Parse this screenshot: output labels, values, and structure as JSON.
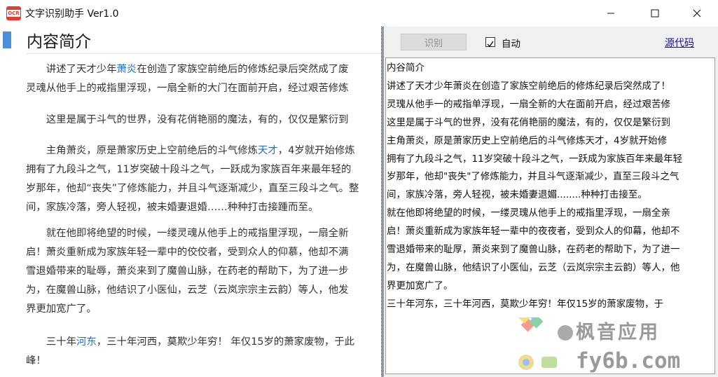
{
  "window": {
    "title": "文字识别助手 Ver1.0",
    "icon_text": "OCR"
  },
  "article": {
    "title": "内容简介",
    "paragraphs": [
      {
        "lines": [
          [
            {
              "t": "　　讲述了天才少年"
            },
            {
              "t": "萧炎",
              "link": true
            },
            {
              "t": "在创造了家族空前绝后的修炼纪录后突然成了废"
            }
          ],
          [
            {
              "t": "灵魂从他手上的戒指里浮现，一扇全新的大门在面前开启，经过艰苦修炼"
            }
          ]
        ]
      },
      {
        "lines": [
          [
            {
              "t": "　　这里是属于斗气的世界，没有花俏艳丽的魔法，有的，仅仅是繁衍到"
            }
          ]
        ]
      },
      {
        "lines": [
          [
            {
              "t": "　　主角萧炎，原是萧家历史上空前绝后的斗气修炼"
            },
            {
              "t": "天才",
              "link": true
            },
            {
              "t": "，4岁就开始修炼"
            }
          ],
          [
            {
              "t": "拥有了九段斗之气，11岁突破十段斗之气，一跃成为家族百年来最年轻的"
            }
          ],
          [
            {
              "t": "岁那年，他却“丧失”了修炼能力，并且斗气逐渐减少，直至三段斗之气。整"
            }
          ],
          [
            {
              "t": "间，家族冷落，旁人轻视，被未婚妻退婚……种种打击接踵而至。"
            }
          ]
        ]
      },
      {
        "lines": [
          [
            {
              "t": "　　就在他即将绝望的时候，一缕灵魂从他手上的戒指里浮现，一扇全新"
            }
          ],
          [
            {
              "t": "启！萧炎重新成为家族年轻一辈中的佼佼者，受到众人的仰慕，他却不满"
            }
          ],
          [
            {
              "t": "雪退婚带来的耻辱，萧炎来到了魔兽山脉，在药老的帮助下，为了进一步"
            }
          ],
          [
            {
              "t": "为，在魔兽山脉，他结识了小医仙，云芝（云岚宗宗主云韵）等人，他发"
            }
          ],
          [
            {
              "t": "界更加宽广了。"
            }
          ]
        ]
      },
      {
        "lines": [
          [
            {
              "t": "　　三十年"
            },
            {
              "t": "河东",
              "link": true
            },
            {
              "t": "，三十年河西，莫欺少年穷！ 年仅15岁的萧家废物，于此"
            }
          ],
          [
            {
              "t": "峰！"
            }
          ]
        ]
      }
    ]
  },
  "toolbar": {
    "recognize_label": "识别",
    "auto_label": "自动",
    "auto_checked": true,
    "source_link": "源代码"
  },
  "output": {
    "lines": [
      "内谷简介",
      "讲述了天才少年萧炎在创造了家族空前绝后的修炼纪录后突然成了！",
      "灵瑰从他手一的戒指单浮现，一扇全新的大在面前开启，经过艰苦修",
      "这里是属于斗气的世界，没有花俏艳丽的魔法，有的，仅仅是繁衍到",
      "主角萧炎，原是萧家历史上空前绝后的斗气修炼天才，4岁就开始修",
      "拥有了九段斗之气，11岁突破十段斗之气，一跃成为家族百年来最年轻",
      "岁那年，他却\"丧失\"了修炼能力，并且斗气逐渐减少，直至三段斗之气",
      "间，家族冷落，旁人轻视，被未婚妻退媚........种种打击接至。",
      "就在他即将绝望的时候，一缕灵瑰从他手上的戒指里浮现，一扇全亲",
      "启！萧炎重新成为家族年轻一辈中的夜夜者，受到众人的仰幕，他却不",
      "雪退婚带来的耻厚，萧炎来到了魔兽山脉，在药老的帮助下，为了进一",
      "为，在魔兽山脉，他结识了小医仙，云芝（云岚宗宗主云韵）等人，他",
      "界更加宽广了。",
      "三十年河东，三十年河西，莫欺少年穷！年仅15岁的萧家废物，于"
    ]
  },
  "watermark": {
    "line1": "枫音应用",
    "line2": "fy6b.com"
  },
  "colors": {
    "accent_bar": "#4a90d9",
    "link": "#2a6fb8",
    "source_link": "#1a0dab"
  }
}
